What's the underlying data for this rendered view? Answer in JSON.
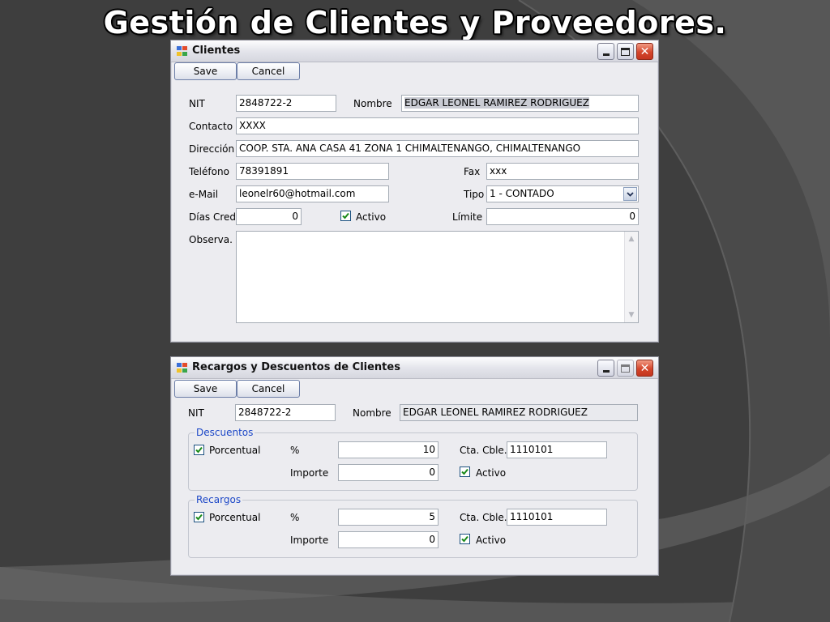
{
  "slide": {
    "title": "Gestión de Clientes y Proveedores."
  },
  "clientes_window": {
    "title": "Clientes",
    "toolbar": {
      "save_label": "Save",
      "cancel_label": "Cancel"
    },
    "fields": {
      "nit_label": "NIT",
      "nit_value": "2848722-2",
      "nombre_label": "Nombre",
      "nombre_value": "EDGAR LEONEL RAMIREZ RODRIGUEZ",
      "contacto_label": "Contacto",
      "contacto_value": "XXXX",
      "direccion_label": "Dirección",
      "direccion_value": "COOP. STA. ANA CASA 41 ZONA 1 CHIMALTENANGO, CHIMALTENANGO",
      "telefono_label": "Teléfono",
      "telefono_value": "78391891",
      "fax_label": "Fax",
      "fax_value": "xxx",
      "email_label": "e-Mail",
      "email_value": "leonelr60@hotmail.com",
      "tipo_label": "Tipo",
      "tipo_value": "1 - CONTADO",
      "dias_cred_label": "Días Cred.",
      "dias_cred_value": "0",
      "activo_label": "Activo",
      "activo_checked": true,
      "limite_label": "Límite",
      "limite_value": "0",
      "observa_label": "Observa.",
      "observa_value": ""
    }
  },
  "recargos_window": {
    "title": "Recargos y Descuentos de Clientes",
    "toolbar": {
      "save_label": "Save",
      "cancel_label": "Cancel"
    },
    "nit_label": "NIT",
    "nit_value": "2848722-2",
    "nombre_label": "Nombre",
    "nombre_value": "EDGAR LEONEL RAMIREZ RODRIGUEZ",
    "descuentos": {
      "legend": "Descuentos",
      "porcentual_label": "Porcentual",
      "porcentual_checked": true,
      "pct_label": "%",
      "pct_value": "10",
      "cta_label": "Cta. Cble.",
      "cta_value": "1110101",
      "importe_label": "Importe",
      "importe_value": "0",
      "activo_label": "Activo",
      "activo_checked": true
    },
    "recargos": {
      "legend": "Recargos",
      "porcentual_label": "Porcentual",
      "porcentual_checked": true,
      "pct_label": "%",
      "pct_value": "5",
      "cta_label": "Cta. Cble.",
      "cta_value": "1110101",
      "importe_label": "Importe",
      "importe_value": "0",
      "activo_label": "Activo",
      "activo_checked": true
    }
  },
  "icons": {
    "app": "app-icon",
    "minimize": "minimize-icon",
    "maximize": "maximize-icon",
    "close": "close-icon",
    "check": "checkmark-icon",
    "dropdown": "chevron-down-icon"
  },
  "colors": {
    "legend": "#1c47c7",
    "close_button": "#d4452b",
    "background": "#3f3f3f"
  }
}
